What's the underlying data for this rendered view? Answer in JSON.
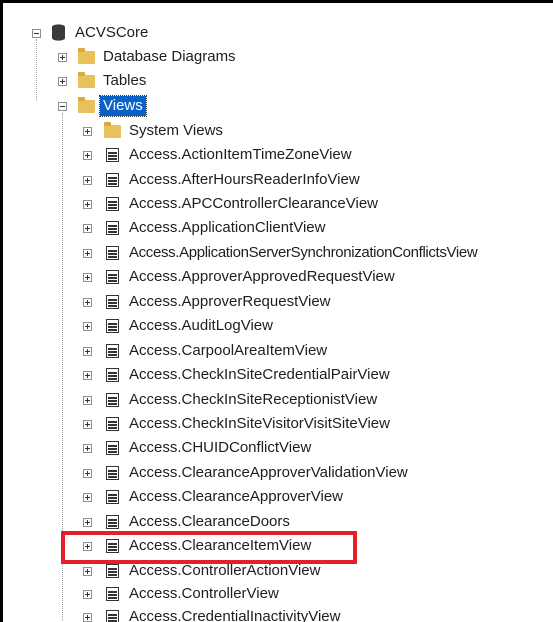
{
  "root": {
    "label": "ACVSCore",
    "icon": "database-icon",
    "expanded": true
  },
  "folders": [
    {
      "label": "Database Diagrams",
      "icon": "folder-icon",
      "expanded": false
    },
    {
      "label": "Tables",
      "icon": "folder-icon",
      "expanded": false
    },
    {
      "label": "Views",
      "icon": "folder-icon",
      "expanded": true,
      "selected": true
    }
  ],
  "views_children": [
    {
      "label": "System Views",
      "icon": "folder-icon"
    },
    {
      "label": "Access.ActionItemTimeZoneView",
      "icon": "view-icon"
    },
    {
      "label": "Access.AfterHoursReaderInfoView",
      "icon": "view-icon"
    },
    {
      "label": "Access.APCControllerClearanceView",
      "icon": "view-icon"
    },
    {
      "label": "Access.ApplicationClientView",
      "icon": "view-icon"
    },
    {
      "label": "Access.ApplicationServerSynchronizationConflictsView",
      "icon": "view-icon"
    },
    {
      "label": "Access.ApproverApprovedRequestView",
      "icon": "view-icon"
    },
    {
      "label": "Access.ApproverRequestView",
      "icon": "view-icon"
    },
    {
      "label": "Access.AuditLogView",
      "icon": "view-icon"
    },
    {
      "label": "Access.CarpoolAreaItemView",
      "icon": "view-icon"
    },
    {
      "label": "Access.CheckInSiteCredentialPairView",
      "icon": "view-icon"
    },
    {
      "label": "Access.CheckInSiteReceptionistView",
      "icon": "view-icon"
    },
    {
      "label": "Access.CheckInSiteVisitorVisitSiteView",
      "icon": "view-icon"
    },
    {
      "label": "Access.CHUIDConflictView",
      "icon": "view-icon"
    },
    {
      "label": "Access.ClearanceApproverValidationView",
      "icon": "view-icon"
    },
    {
      "label": "Access.ClearanceApproverView",
      "icon": "view-icon"
    },
    {
      "label": "Access.ClearanceDoors",
      "icon": "view-icon"
    },
    {
      "label": "Access.ClearanceItemView",
      "icon": "view-icon",
      "highlighted": true
    },
    {
      "label": "Access.ControllerActionView",
      "icon": "view-icon"
    },
    {
      "label": "Access.ControllerView",
      "icon": "view-icon"
    },
    {
      "label": "Access.CredentialInactivityView",
      "icon": "view-icon"
    }
  ],
  "colors": {
    "selection": "#0a62c8",
    "highlight_box": "#e41e2b",
    "folder": "#e8c15c"
  }
}
